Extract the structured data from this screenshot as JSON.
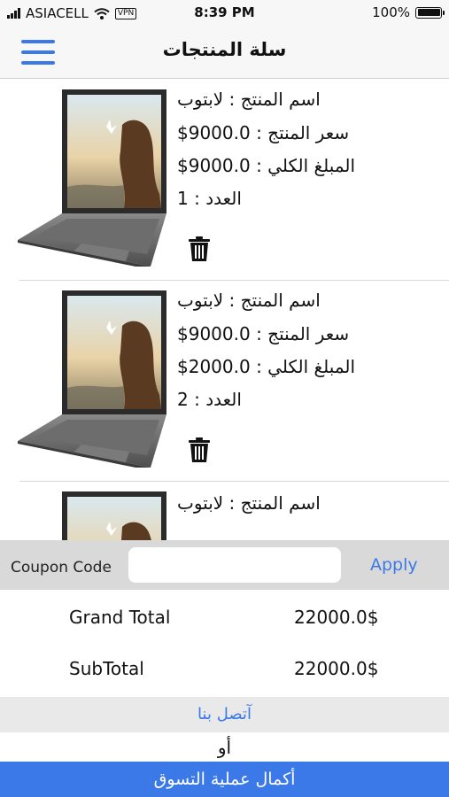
{
  "status_bar": {
    "carrier": "ASIACELL",
    "vpn": "VPN",
    "time": "8:39 PM",
    "battery": "100%"
  },
  "nav": {
    "title": "سلة المنتجات"
  },
  "products": [
    {
      "name": "اسم المنتج : لابتوب",
      "price": "سعر المنتج : 9000.0$",
      "total": "المبلغ الكلي : 9000.0$",
      "quantity": "العدد : 1"
    },
    {
      "name": "اسم المنتج : لابتوب",
      "price": "سعر المنتج : 9000.0$",
      "total": "المبلغ الكلي : 2000.0$",
      "quantity": "العدد : 2"
    },
    {
      "name": "اسم المنتج : لابتوب"
    }
  ],
  "coupon": {
    "label": "Coupon Code",
    "placeholder": "",
    "value": "",
    "apply_label": "Apply"
  },
  "totals": {
    "grand_total_label": "Grand Total",
    "grand_total_value": "22000.0$",
    "subtotal_label": "SubTotal",
    "subtotal_value": "22000.0$"
  },
  "footer": {
    "contact_label": "آتصل بنا",
    "or_label": "أو",
    "checkout_label": "أكمال عملية التسوق"
  },
  "colors": {
    "accent": "#3b79e8",
    "coupon_bar": "#d9d9d9",
    "contact_bar": "#e9e9e9"
  }
}
